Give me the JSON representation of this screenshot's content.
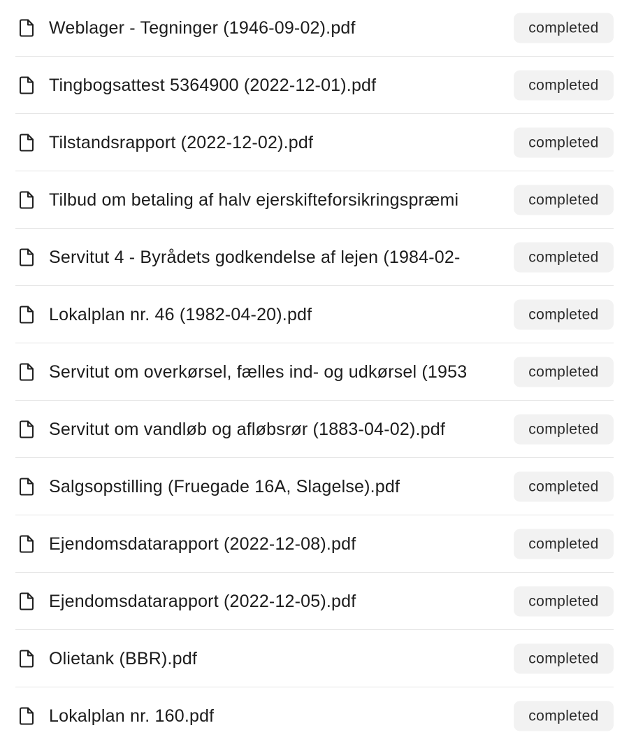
{
  "file_list": {
    "items": [
      {
        "name": "Weblager - Tegninger (1946-09-02).pdf",
        "status": "completed",
        "icon": "file-icon"
      },
      {
        "name": "Tingbogsattest 5364900 (2022-12-01).pdf",
        "status": "completed",
        "icon": "file-icon"
      },
      {
        "name": "Tilstandsrapport (2022-12-02).pdf",
        "status": "completed",
        "icon": "file-icon"
      },
      {
        "name": "Tilbud om betaling af halv ejerskifteforsikringspræmi",
        "status": "completed",
        "icon": "file-icon"
      },
      {
        "name": "Servitut 4 - Byrådets godkendelse af lejen (1984-02-",
        "status": "completed",
        "icon": "file-icon"
      },
      {
        "name": "Lokalplan nr. 46 (1982-04-20).pdf",
        "status": "completed",
        "icon": "file-icon"
      },
      {
        "name": "Servitut om overkørsel, fælles ind- og udkørsel (1953",
        "status": "completed",
        "icon": "file-icon"
      },
      {
        "name": "Servitut om vandløb og afløbsrør (1883-04-02).pdf",
        "status": "completed",
        "icon": "file-icon"
      },
      {
        "name": "Salgsopstilling (Fruegade 16A, Slagelse).pdf",
        "status": "completed",
        "icon": "file-icon"
      },
      {
        "name": "Ejendomsdatarapport (2022-12-08).pdf",
        "status": "completed",
        "icon": "file-icon"
      },
      {
        "name": "Ejendomsdatarapport (2022-12-05).pdf",
        "status": "completed",
        "icon": "file-icon"
      },
      {
        "name": "Olietank (BBR).pdf",
        "status": "completed",
        "icon": "file-icon"
      },
      {
        "name": "Lokalplan nr. 160.pdf",
        "status": "completed",
        "icon": "file-icon"
      }
    ]
  },
  "colors": {
    "badge_background": "#f2f2f2",
    "divider": "#e4e4e4",
    "text": "#1c1c1c"
  }
}
